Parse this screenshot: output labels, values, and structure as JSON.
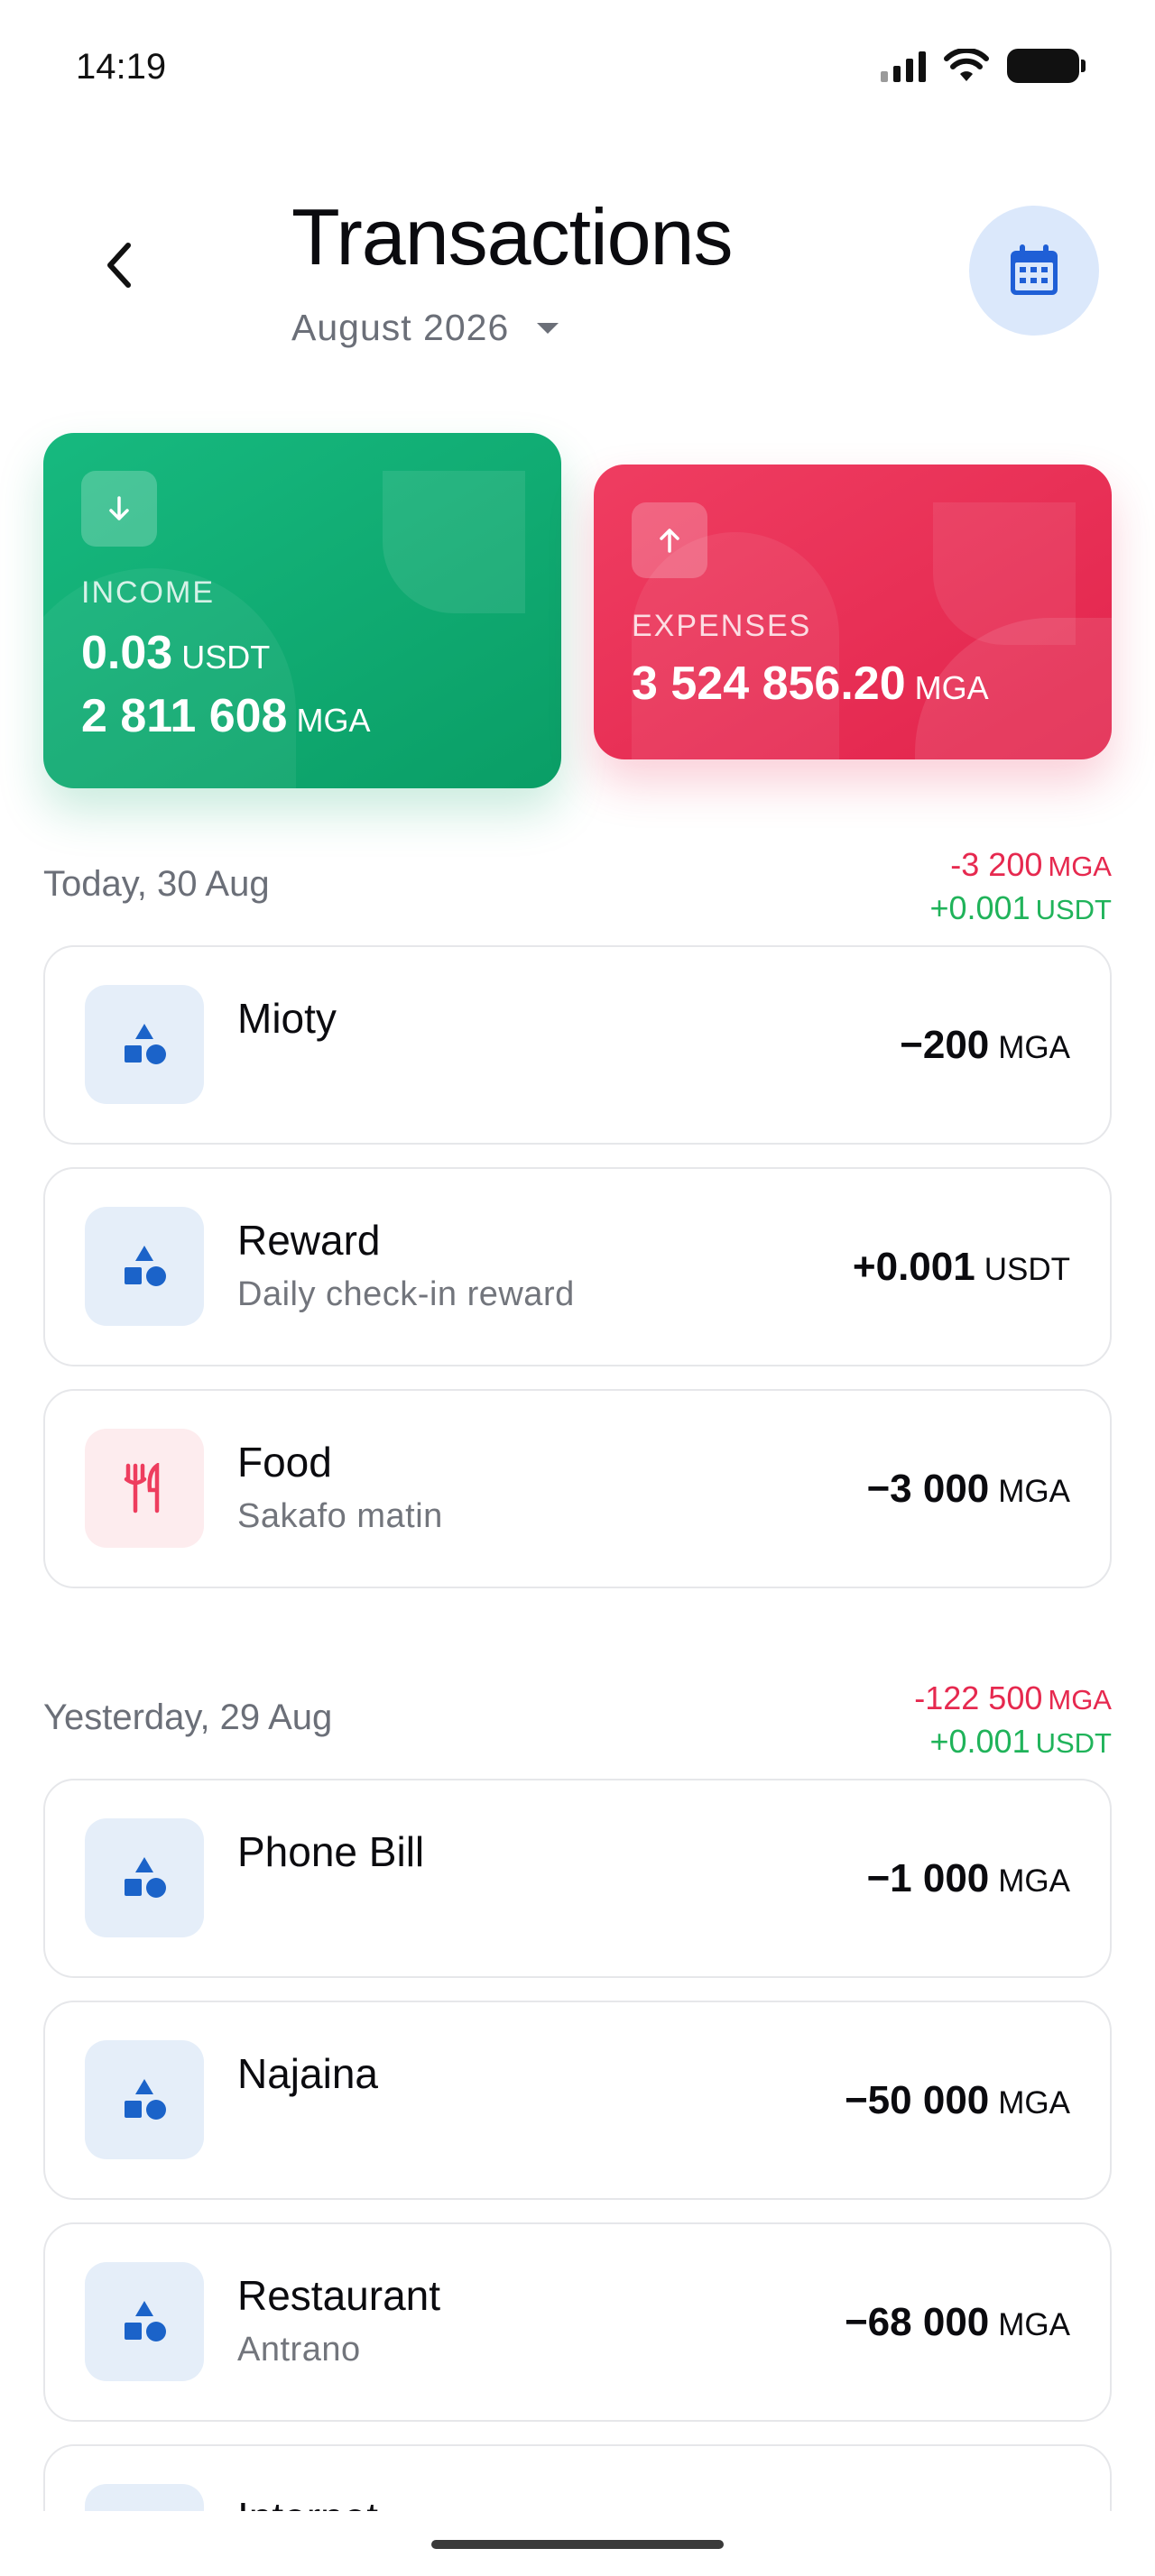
{
  "status_bar": {
    "time": "14:19"
  },
  "header": {
    "title": "Transactions",
    "month": "August 2026"
  },
  "summary": {
    "income": {
      "label": "INCOME",
      "amount_1": "0.03",
      "currency_1": "USDT",
      "amount_2": "2 811 608",
      "currency_2": "MGA"
    },
    "expenses": {
      "label": "EXPENSES",
      "amount": "3 524 856.20",
      "currency": "MGA"
    }
  },
  "groups": [
    {
      "label": "Today, 30 Aug",
      "total_negative": "-3 200",
      "total_negative_currency": "MGA",
      "total_positive": "+0.001",
      "total_positive_currency": "USDT",
      "transactions": [
        {
          "title": "Mioty",
          "subtitle": "",
          "amount": "−200",
          "currency": "MGA",
          "icon": "shapes-icon"
        },
        {
          "title": "Reward",
          "subtitle": "Daily check-in reward",
          "amount": "+0.001",
          "currency": "USDT",
          "icon": "shapes-icon"
        },
        {
          "title": "Food",
          "subtitle": "Sakafo matin",
          "amount": "−3 000",
          "currency": "MGA",
          "icon": "fork-knife-icon"
        }
      ]
    },
    {
      "label": "Yesterday, 29 Aug",
      "total_negative": "-122 500",
      "total_negative_currency": "MGA",
      "total_positive": "+0.001",
      "total_positive_currency": "USDT",
      "transactions": [
        {
          "title": "Phone Bill",
          "subtitle": "",
          "amount": "−1 000",
          "currency": "MGA",
          "icon": "shapes-icon"
        },
        {
          "title": "Najaina",
          "subtitle": "",
          "amount": "−50 000",
          "currency": "MGA",
          "icon": "shapes-icon"
        },
        {
          "title": "Restaurant",
          "subtitle": "Antrano",
          "amount": "−68 000",
          "currency": "MGA",
          "icon": "shapes-icon"
        },
        {
          "title": "Internet",
          "subtitle": "",
          "amount": "",
          "currency": "",
          "icon": "shapes-icon"
        }
      ]
    }
  ],
  "colors": {
    "income_green": "#0fa872",
    "expense_red": "#e8284f",
    "positive_text": "#20b35a",
    "negative_text": "#e6294f",
    "accent_blue": "#1f5fd6"
  }
}
